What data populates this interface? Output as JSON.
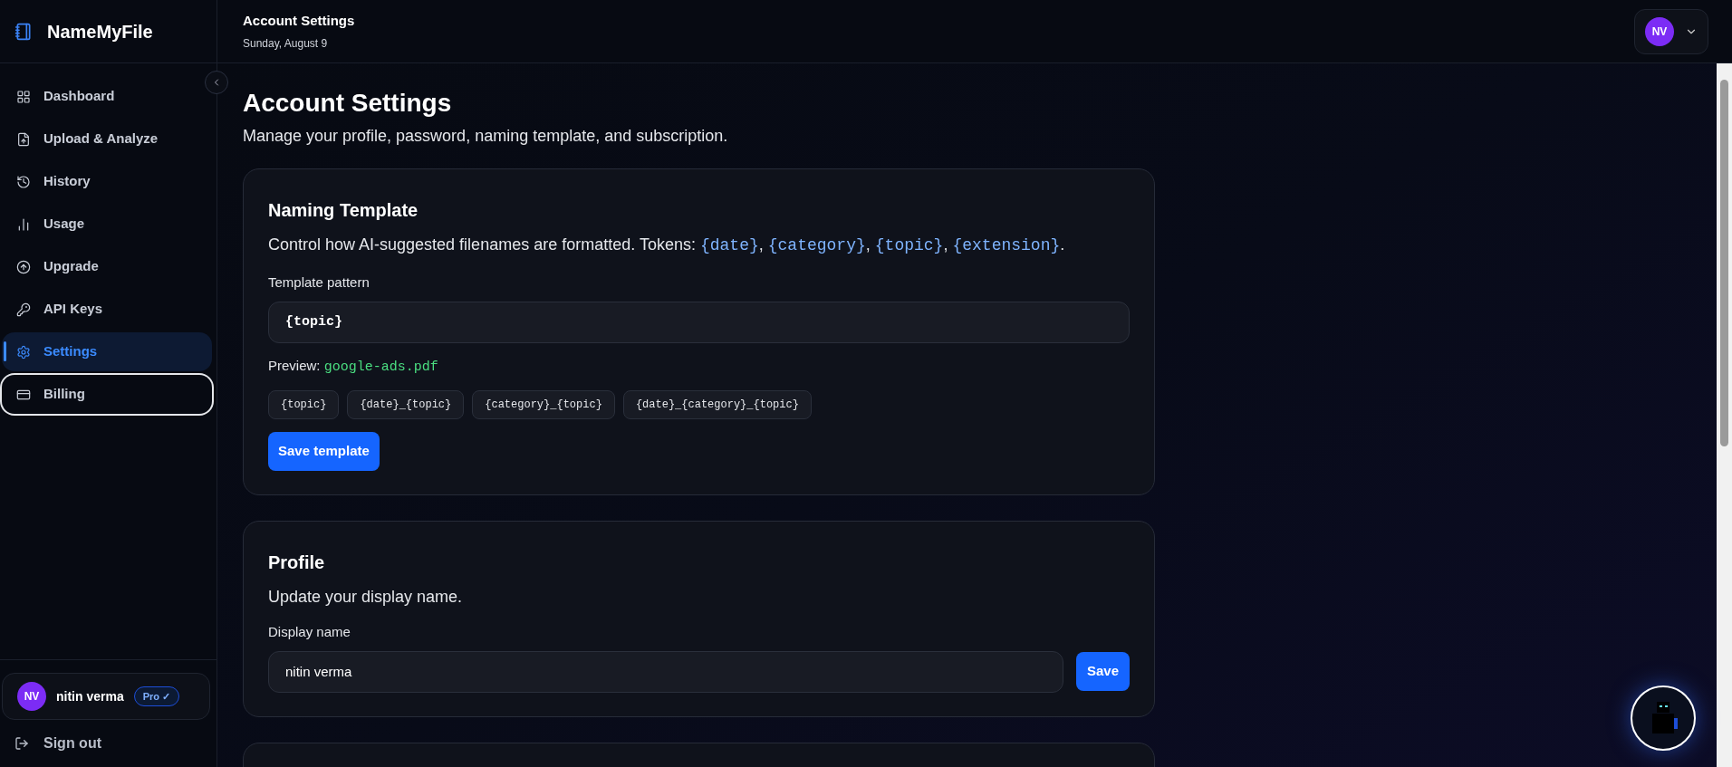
{
  "brand": {
    "name": "NameMyFile"
  },
  "sidebar": {
    "items": [
      {
        "label": "Dashboard",
        "selected": false,
        "focused": false
      },
      {
        "label": "Upload & Analyze",
        "selected": false,
        "focused": false
      },
      {
        "label": "History",
        "selected": false,
        "focused": false
      },
      {
        "label": "Usage",
        "selected": false,
        "focused": false
      },
      {
        "label": "Upgrade",
        "selected": false,
        "focused": false
      },
      {
        "label": "API Keys",
        "selected": false,
        "focused": false
      },
      {
        "label": "Settings",
        "selected": true,
        "focused": false
      },
      {
        "label": "Billing",
        "selected": false,
        "focused": true
      }
    ],
    "user": {
      "initials": "NV",
      "name": "nitin verma",
      "badge": "Pro ✓"
    },
    "sign_out": "Sign out"
  },
  "header": {
    "title": "Account Settings",
    "date": "Sunday, August 9",
    "avatar": "NV"
  },
  "page": {
    "title": "Account Settings",
    "subtitle": "Manage your profile, password, naming template, and subscription."
  },
  "naming_template": {
    "title": "Naming Template",
    "description": [
      {
        "kind": "plain",
        "text": "Control how AI-suggested filenames are formatted. Tokens: "
      },
      {
        "kind": "token",
        "text": "{date}",
        "suffix": ", "
      },
      {
        "kind": "token",
        "text": "{category}",
        "suffix": ", "
      },
      {
        "kind": "token",
        "text": "{topic}",
        "suffix": ", "
      },
      {
        "kind": "token",
        "text": "{extension}",
        "suffix": "."
      }
    ],
    "field_label": "Template pattern",
    "value": "{topic}",
    "preview_label": "Preview: ",
    "preview_value": "google-ads.pdf",
    "presets": [
      "{topic}",
      "{date}_{topic}",
      "{category}_{topic}",
      "{date}_{category}_{topic}"
    ],
    "button": "Save template"
  },
  "profile": {
    "title": "Profile",
    "description": "Update your display name.",
    "field_label": "Display name",
    "value": "nitin verma",
    "button": "Save"
  }
}
